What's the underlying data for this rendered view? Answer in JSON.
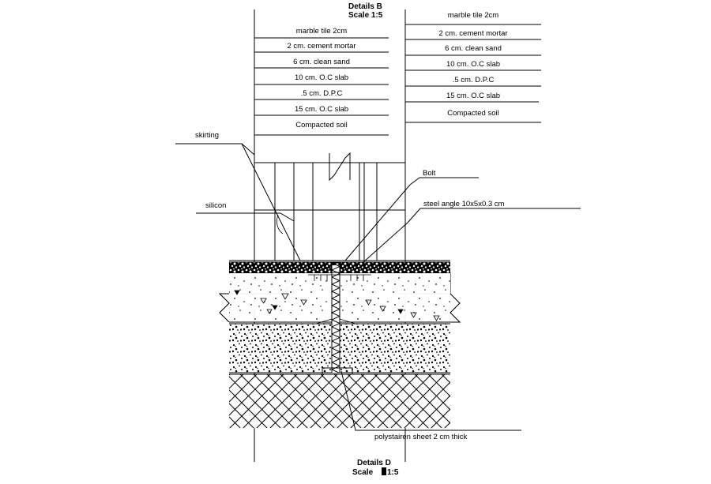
{
  "drawing": {
    "title_top": {
      "name": "Details B",
      "scale": "Scale  1:5"
    },
    "title_bottom": {
      "name": "Details D",
      "scale_prefix": "Scale",
      "scale_value": "1:5"
    },
    "layer_table_left": {
      "rows": [
        "marble tile 2cm",
        "2 cm. cement mortar",
        "6 cm. clean sand",
        "10 cm. O.C slab",
        ".5 cm. D.P.C",
        "15 cm. O.C slab",
        "Compacted soil"
      ]
    },
    "layer_table_right": {
      "rows": [
        "marble tile 2cm",
        "2 cm. cement mortar",
        "6 cm. clean sand",
        "10 cm. O.C slab",
        ".5 cm. D.P.C",
        "15 cm. O.C slab",
        "Compacted soil"
      ]
    },
    "annotations": {
      "skirting": "skirting",
      "silicon": "silicon",
      "bolt": "Bolt",
      "steel_angle": "steel angle 10x5x0.3 cm",
      "polystyrene": "polystairen sheet 2 cm thick"
    },
    "colors": {
      "line": "#000000",
      "background": "#ffffff"
    }
  }
}
